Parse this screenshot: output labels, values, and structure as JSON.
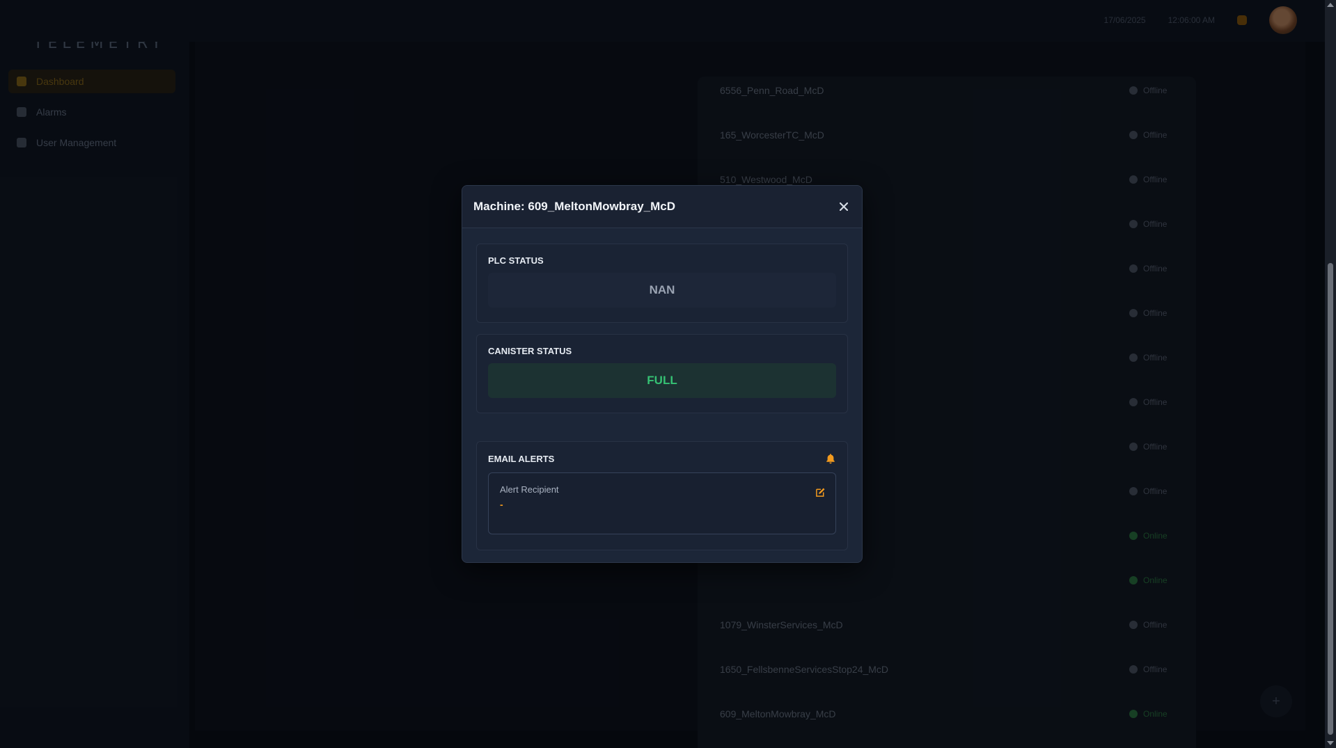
{
  "app": {
    "logo_text": "TELEMETRY",
    "sidebar": {
      "items": [
        {
          "label": "Dashboard",
          "icon": "home-icon",
          "active": true
        },
        {
          "label": "Alarms",
          "icon": "alarm-icon",
          "active": false
        },
        {
          "label": "User Management",
          "icon": "users-icon",
          "active": false
        }
      ]
    },
    "topbar": {
      "date": "17/06/2025",
      "time": "12:06:00 AM"
    },
    "machine_list": {
      "rows": [
        {
          "name": "6556_Penn_Road_McD",
          "status": "Offline"
        },
        {
          "name": "165_WorcesterTC_McD",
          "status": "Offline"
        },
        {
          "name": "510_Westwood_McD",
          "status": "Offline"
        },
        {
          "name": "",
          "status": "Offline"
        },
        {
          "name": "",
          "status": "Offline"
        },
        {
          "name": "",
          "status": "Offline"
        },
        {
          "name": "",
          "status": "Offline"
        },
        {
          "name": "",
          "status": "Offline"
        },
        {
          "name": "",
          "status": "Offline"
        },
        {
          "name": "",
          "status": "Offline"
        },
        {
          "name": "",
          "status": "Online"
        },
        {
          "name": "",
          "status": "Online"
        },
        {
          "name": "1079_WinsterServices_McD",
          "status": "Offline"
        },
        {
          "name": "1650_FellsbenneServicesStop24_McD",
          "status": "Offline"
        },
        {
          "name": "609_MeltonMowbray_McD",
          "status": "Online"
        }
      ]
    },
    "fab_icon": "plus-icon"
  },
  "modal": {
    "title": "Machine: 609_MeltonMowbray_McD",
    "close_icon": "close-icon",
    "plc": {
      "title": "PLC STATUS",
      "value": "NAN"
    },
    "canister": {
      "title": "CANISTER STATUS",
      "value": "FULL"
    },
    "alerts": {
      "title": "EMAIL ALERTS",
      "icon": "bell-icon",
      "recipient_label": "Alert Recipient",
      "recipient_value": "-",
      "edit_icon": "edit-icon"
    }
  },
  "colors": {
    "accent": "#f29a1e",
    "success": "#35c173",
    "modal_bg": "#1c2638"
  }
}
